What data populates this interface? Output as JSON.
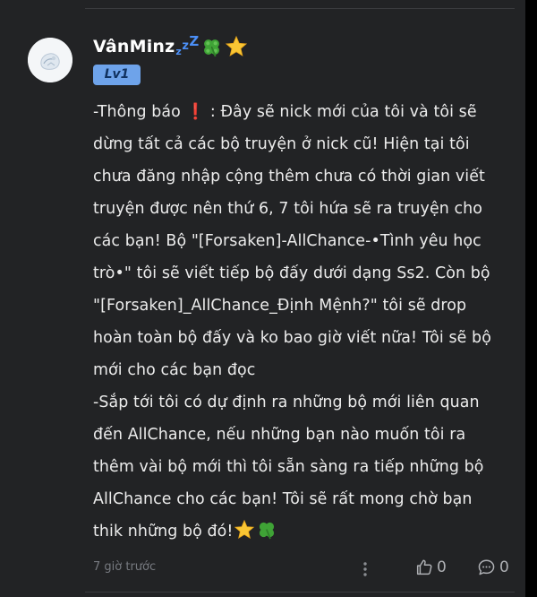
{
  "comment": {
    "author": {
      "name": "VânMinz",
      "zzz": [
        "z",
        "z",
        "Z"
      ],
      "badge_emojis": [
        "clover-icon",
        "star-icon"
      ],
      "level": "Lv1"
    },
    "body_lines": [
      "-Thông báo ❗ : Đây sẽ nick mới của tôi và tôi sẽ",
      "dừng tất cả các bộ truyện ở nick cũ! Hiện tại tôi",
      "chưa đăng nhập cộng thêm chưa có thời gian viết",
      "truyện được nên thứ 6, 7 tôi hứa sẽ ra truyện cho",
      "các bạn! Bộ \"[Forsaken]-AllChance-•Tình yêu học",
      "trò•\" tôi sẽ viết tiếp bộ đấy dưới dạng Ss2. Còn bộ",
      "\"[Forsaken]_AllChance_Định Mệnh?\" tôi sẽ drop",
      "hoàn toàn bộ đấy và ko bao giờ viết nữa! Tôi sẽ bộ",
      "mới cho các bạn đọc",
      "-Sắp tới tôi có dự định ra những bộ mới liên quan",
      "đến AllChance, nếu những bạn nào muốn tôi ra",
      "thêm vài bộ mới thì tôi sẵn sàng ra tiếp những bộ",
      "AllChance cho các bạn! Tôi sẽ rất mong chờ bạn",
      "thik những bộ đó!"
    ],
    "timestamp": "7 giờ trước",
    "likes": "0",
    "replies": "0"
  },
  "colors": {
    "background": "#222325",
    "text": "#ececec",
    "zzz": "#4b8ff7",
    "badge": "#6ea3ea",
    "muted": "#777a80"
  }
}
